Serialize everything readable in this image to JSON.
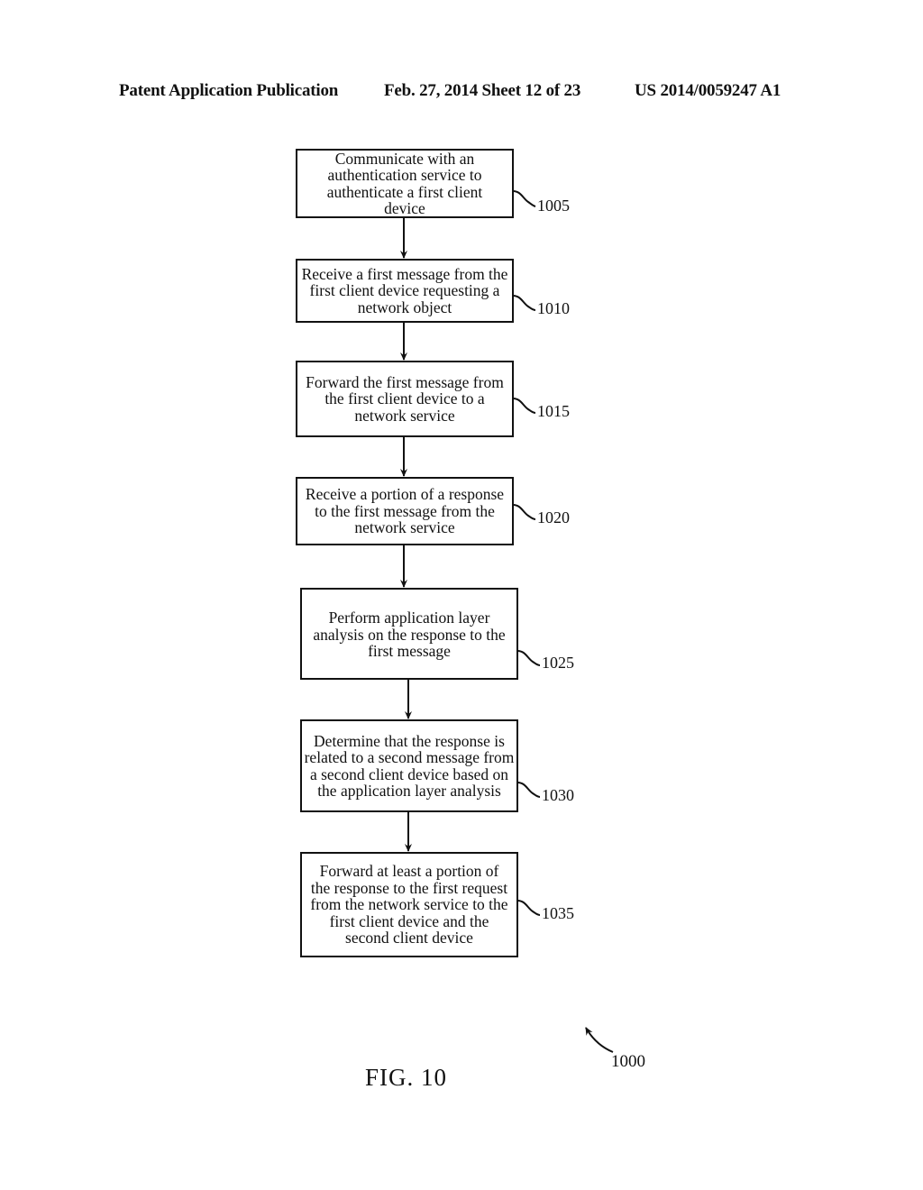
{
  "header": {
    "publication": "Patent Application Publication",
    "date_sheet": "Feb. 27, 2014  Sheet 12 of 23",
    "number": "US 2014/0059247 A1"
  },
  "steps": [
    {
      "ref": "1005",
      "text": "Communicate with an authentication service to authenticate a first client device"
    },
    {
      "ref": "1010",
      "text": "Receive a first message from the first client device requesting a network object"
    },
    {
      "ref": "1015",
      "text": "Forward the first message from the first client device to a network service"
    },
    {
      "ref": "1020",
      "text": "Receive a portion of a response to the first message from the network service"
    },
    {
      "ref": "1025",
      "text": "Perform application layer analysis on the response to the first message"
    },
    {
      "ref": "1030",
      "text": "Determine that the response is related to a second message from a second client device based on the application layer analysis"
    },
    {
      "ref": "1035",
      "text": "Forward at least a portion of the response to the first request from the network service to the first client device and the second client device"
    }
  ],
  "figure": {
    "label": "FIG.  10",
    "ref": "1000"
  }
}
